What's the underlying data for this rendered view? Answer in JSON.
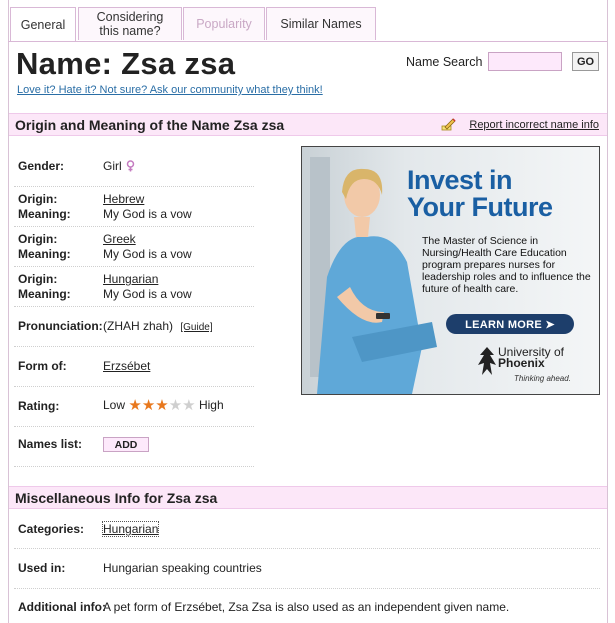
{
  "tabs": [
    {
      "label": "General"
    },
    {
      "label": "Considering this name?"
    },
    {
      "label": "Popularity"
    },
    {
      "label": "Similar Names"
    }
  ],
  "header": {
    "title": "Name: Zsa zsa",
    "community_link": "Love it? Hate it? Not sure? Ask our community what they think!",
    "search_label": "Name Search",
    "search_value": "",
    "go_label": "GO"
  },
  "origin_section": {
    "title": "Origin and Meaning of the Name Zsa zsa",
    "report_link": "Report incorrect name info"
  },
  "info": {
    "gender_label": "Gender:",
    "gender_value": "Girl",
    "origin_label": "Origin:",
    "meaning_label": "Meaning:",
    "origins": [
      {
        "origin": "Hebrew",
        "meaning": "My God is a vow"
      },
      {
        "origin": "Greek",
        "meaning": "My God is a vow"
      },
      {
        "origin": "Hungarian",
        "meaning": "My God is a vow"
      }
    ],
    "pronunciation_label": "Pronunciation:",
    "pronunciation_value": "(ZHAH zhah)",
    "guide_label": "[Guide]",
    "form_label": "Form of:",
    "form_value": "Erzsébet",
    "rating_label": "Rating:",
    "rating_low": "Low",
    "rating_high": "High",
    "rating_stars": 3,
    "rating_max": 5,
    "names_list_label": "Names list:",
    "add_label": "ADD"
  },
  "ad": {
    "headline_1": "Invest in",
    "headline_2": "Your Future",
    "body": "The Master of Science in Nursing/Health Care Education program prepares nurses for leadership roles and to influence the future of health care.",
    "cta": "LEARN MORE ➤",
    "brand_1": "University of",
    "brand_2": "Phoenix",
    "tagline": "Thinking ahead."
  },
  "misc_section": {
    "title": "Miscellaneous Info for Zsa zsa",
    "categories_label": "Categories:",
    "categories_value": "Hungarian",
    "used_label": "Used in:",
    "used_value": "Hungarian speaking countries",
    "additional_label": "Additional info:",
    "additional_value": "A pet form of Erzsébet, Zsa Zsa is also used as an independent given name."
  },
  "colors": {
    "accent_pink": "#fce7f8",
    "star_on": "#e8781e",
    "star_off": "#cfcfcf",
    "link_blue": "#2a6ea6"
  }
}
